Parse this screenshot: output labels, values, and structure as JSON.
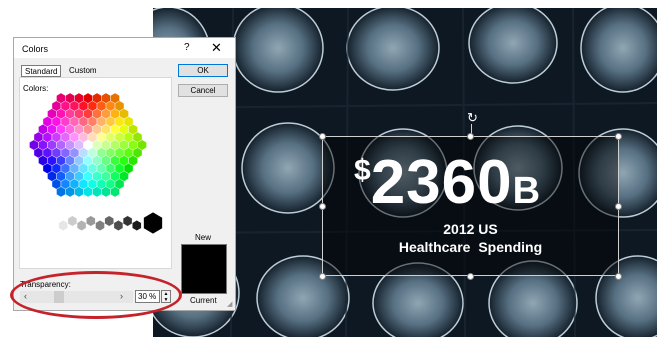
{
  "slide": {
    "dollar_sign": "$",
    "amount": "2360",
    "unit": "B",
    "line1": "2012 US",
    "line2": "Healthcare Spending"
  },
  "dialog": {
    "title": "Colors",
    "help": "?",
    "close": "✕",
    "tabs": [
      "Standard",
      "Custom"
    ],
    "colors_label": "Colors:",
    "ok": "OK",
    "cancel": "Cancel",
    "new_label": "New",
    "current_label": "Current",
    "new_color": "#000000",
    "transparency_label": "Transparency:",
    "transparency_value": "30 %",
    "transparency_fraction": 0.3,
    "left_arrow": "‹",
    "right_arrow": "›"
  },
  "annotation_color": "#c4232b"
}
